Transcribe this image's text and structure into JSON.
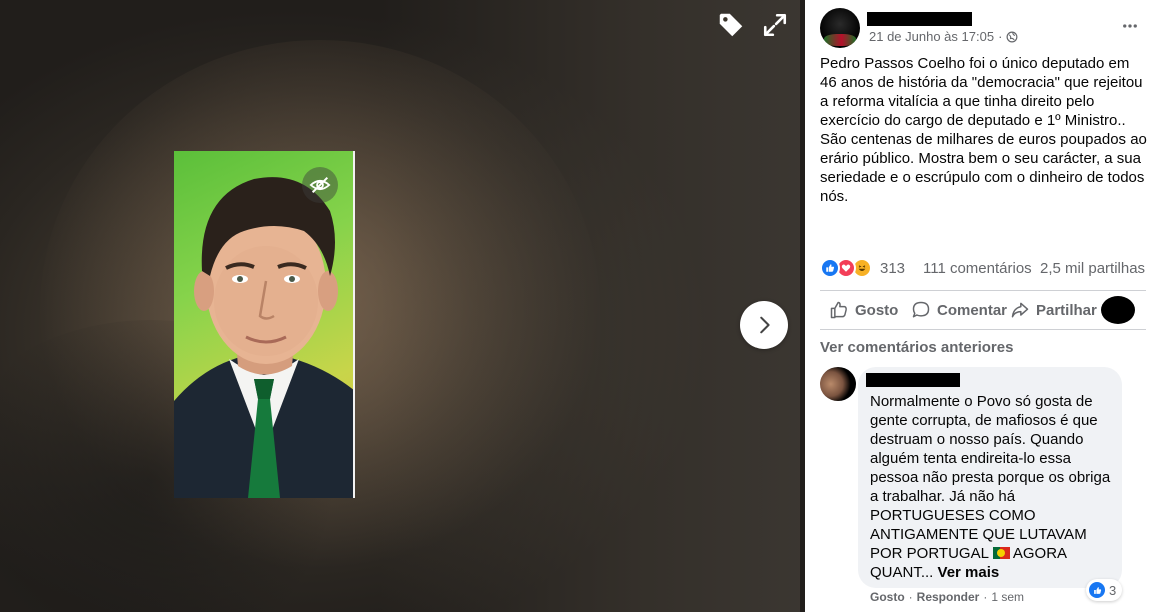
{
  "viewer": {
    "icons": {
      "tag": "tag-icon",
      "expand": "expand-icon",
      "hidden": "eye-slash-icon",
      "next": "chevron-right-icon"
    }
  },
  "post": {
    "timestamp": "21 de Junho às 17:05",
    "privacy_icon": "globe-icon",
    "text": [
      "Pedro Passos Coelho foi o único deputado em 46 anos de história da \"democracia\" que rejeitou a reforma vitalícia a que tinha direito pelo exercício do cargo de deputado e 1º Ministro..",
      "São centenas de milhares de euros poupados ao erário público. Mostra bem o seu carácter, a sua seriedade e o escrúpulo com o dinheiro de todos nós."
    ],
    "reactions_count": "313",
    "comments_count": "111 comentários",
    "shares_count": "2,5 mil partilhas",
    "actions": {
      "like": "Gosto",
      "comment": "Comentar",
      "share": "Partilhar"
    },
    "view_previous": "Ver comentários anteriores"
  },
  "comment": {
    "text_part1": "Normalmente o Povo só gosta de gente corrupta, de mafiosos é que destruam o nosso país. Quando alguém tenta endireita-lo essa pessoa não presta porque os obriga a trabalhar. Já não há PORTUGUESES COMO ANTIGAMENTE QUE LUTAVAM POR PORTUGAL",
    "text_part2": "AGORA QUANT...",
    "see_more": "Ver mais",
    "reaction_count": "3",
    "like": "Gosto",
    "reply": "Responder",
    "sep": "·",
    "time": "1 sem"
  },
  "colors": {
    "accent": "#1877f2",
    "secondary_text": "#65676b",
    "bubble": "#f0f2f5"
  }
}
